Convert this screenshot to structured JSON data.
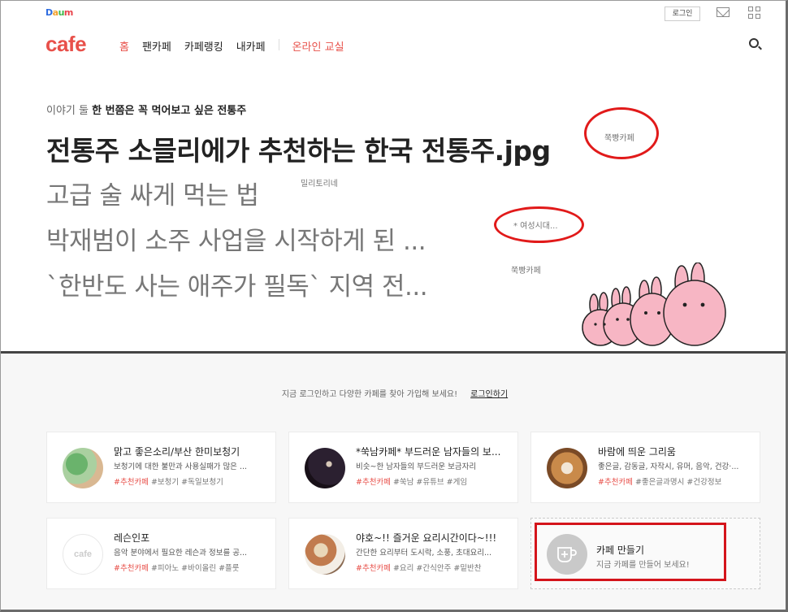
{
  "header": {
    "daum_logo": "Daum",
    "login_button": "로그인",
    "cafe_logo": "cafe",
    "nav": [
      "홈",
      "팬카페",
      "카페랭킹",
      "내카페"
    ],
    "nav_special": "온라인 교실",
    "icons": [
      "mail-icon",
      "apps-grid-icon",
      "search-icon"
    ]
  },
  "feature": {
    "category": "이야기 둘",
    "subtitle": "한 번쯤은 꼭 먹어보고 싶은 전통주",
    "headline": "전통주 소믈리에가 추천하는 한국 전통주.jpg",
    "headline_cafe": "쭉빵카페",
    "stories": [
      {
        "title": "고급 술 싸게 먹는 법",
        "cafe": "밀리토리네"
      },
      {
        "title": "박재범이 소주 사업을 시작하게 된 ...",
        "cafe": "* 여성시대..."
      },
      {
        "title": "`한반도 사는 애주가 필독` 지역 전...",
        "cafe": "쭉빵카페"
      }
    ]
  },
  "login_prompt": {
    "text": "지금 로그인하고 다양한 카페를 찾아 가입해 보세요!",
    "link": "로그인하기"
  },
  "cafes": [
    {
      "name": "맑고 좋은소리/부산 한미보청기",
      "desc": "보청기에 대한 불만과 사용실패가 많은 ...",
      "hot": "#추천카페",
      "tags": "#보청기 #독일보청기"
    },
    {
      "name": "*쑥남카페* 부드러운 남자들의 보...",
      "desc": "비슷~한 남자들의 부드러운 보금자리",
      "hot": "#추천카페",
      "tags": "#쑥남 #유튜브 #게임"
    },
    {
      "name": "바람에 띄운 그리움",
      "desc": "좋은글, 감동글, 자작시, 유머, 음악, 건강·...",
      "hot": "#추천카페",
      "tags": "#좋은글과명시 #건강정보"
    },
    {
      "name": "레슨인포",
      "desc": "음악 분야에서 필요한 레슨과 정보를 공...",
      "hot": "#추천카페",
      "tags": "#피아노 #바이올린 #플룻"
    },
    {
      "name": "야호~!! 즐거운 요리시간이다~!!!",
      "desc": "간단한 요리부터 도시락, 소풍, 초대요리...",
      "hot": "#추천카페",
      "tags": "#요리 #간식안주 #밑반찬"
    }
  ],
  "make_cafe": {
    "name": "카페 만들기",
    "desc": "지금 카페를 만들어 보세요!"
  },
  "colors": {
    "brand": "#e8504a",
    "highlight": "#e11a1a"
  }
}
